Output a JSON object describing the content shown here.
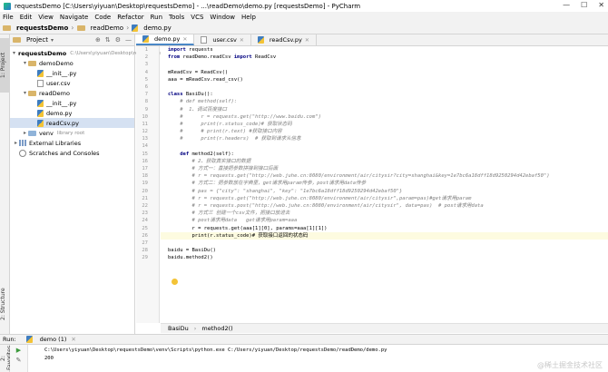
{
  "title_bar": {
    "title": "requestsDemo [C:\\Users\\yiyuan\\Desktop\\requestsDemo] - ...\\readDemo\\demo.py [requestsDemo] - PyCharm",
    "min_icon": "minimize-icon",
    "max_icon": "maximize-icon",
    "close_icon": "close-icon"
  },
  "menu": [
    "File",
    "Edit",
    "View",
    "Navigate",
    "Code",
    "Refactor",
    "Run",
    "Tools",
    "VCS",
    "Window",
    "Help"
  ],
  "breadcrumbs": [
    "requestsDemo",
    "readDemo",
    "demo.py"
  ],
  "side_tabs": {
    "project": "1: Project",
    "structure": "2: Structure",
    "favorites": "2: Favorites"
  },
  "project_panel": {
    "header_label": "Project",
    "tree": [
      {
        "indent": 0,
        "arrow": "▾",
        "icon": "folder",
        "name": "requestsDemo",
        "extra": "C:\\Users\\yiyuan\\Desktop\\requestsDemo",
        "bold": true
      },
      {
        "indent": 1,
        "arrow": "▾",
        "icon": "folder",
        "name": "demoDemo",
        "extra": ""
      },
      {
        "indent": 2,
        "arrow": "",
        "icon": "py",
        "name": "__init__.py",
        "extra": ""
      },
      {
        "indent": 2,
        "arrow": "",
        "icon": "csv",
        "name": "user.csv",
        "extra": ""
      },
      {
        "indent": 1,
        "arrow": "▾",
        "icon": "folder",
        "name": "readDemo",
        "extra": ""
      },
      {
        "indent": 2,
        "arrow": "",
        "icon": "py",
        "name": "__init__.py",
        "extra": ""
      },
      {
        "indent": 2,
        "arrow": "",
        "icon": "py",
        "name": "demo.py",
        "extra": ""
      },
      {
        "indent": 2,
        "arrow": "",
        "icon": "py",
        "name": "readCsv.py",
        "extra": "",
        "selected": true
      },
      {
        "indent": 1,
        "arrow": "▸",
        "icon": "folder-blue",
        "name": "venv",
        "extra": "library root"
      },
      {
        "indent": 0,
        "arrow": "▸",
        "icon": "lib",
        "name": "External Libraries",
        "extra": ""
      },
      {
        "indent": 0,
        "arrow": "",
        "icon": "scratch",
        "name": "Scratches and Consoles",
        "extra": ""
      }
    ]
  },
  "editor_tabs": [
    {
      "label": "demo.py",
      "active": true
    },
    {
      "label": "user.csv",
      "active": false
    },
    {
      "label": "readCsv.py",
      "active": false
    }
  ],
  "code_lines": [
    {
      "n": "1",
      "html": "<span class='kw'>import</span> requests"
    },
    {
      "n": "2",
      "html": "<span class='kw'>from</span> readDemo.readCsv <span class='kw'>import</span> ReadCsv"
    },
    {
      "n": "3",
      "html": ""
    },
    {
      "n": "4",
      "html": "mReadCsv = ReadCsv()"
    },
    {
      "n": "5",
      "html": "aaa = mReadCsv.read_csv()"
    },
    {
      "n": "6",
      "html": ""
    },
    {
      "n": "7",
      "html": "<span class='kw'>class</span> BasiDu():"
    },
    {
      "n": "8",
      "html": "    <span class='cm'># def method(self):</span>"
    },
    {
      "n": "9",
      "html": "    <span class='cm'>#  1、调试百度接口</span>"
    },
    {
      "n": "10",
      "html": "    <span class='cm'>#      r = requests.get(\"http://www.baidu.com\")</span>"
    },
    {
      "n": "11",
      "html": "    <span class='cm'>#      print(r.status_code)# 获取状态码</span>"
    },
    {
      "n": "12",
      "html": "    <span class='cm'>#      # print(r.text) #获取接口内容</span>"
    },
    {
      "n": "13",
      "html": "    <span class='cm'>#      print(r.headers)  # 获取到请求头信息</span>"
    },
    {
      "n": "14",
      "html": ""
    },
    {
      "n": "15",
      "html": "    <span class='kw'>def</span> method2(self):"
    },
    {
      "n": "16",
      "html": "        <span class='cm'># 2、获取真实接口的数据</span>"
    },
    {
      "n": "17",
      "html": "        <span class='cm'># 方式一：直接把参数拼接到接口后面</span>"
    },
    {
      "n": "18",
      "html": "        <span class='cm'># r = requests.get(\"http://web.juhe.cn:8080/environment/air/citysir?city=shanghai&key=1e7bc6a18dff18d9250294d42ebaf50\")</span>"
    },
    {
      "n": "19",
      "html": "        <span class='cm'># 方式二：把参数放在字典里，get请求用param传参，post请求用data传参</span>"
    },
    {
      "n": "20",
      "html": "        <span class='cm'># pas = {\"city\": \"shanghai\", \"key\": \"1e7bc6a18dff18d9250294d42ebaf50\"}</span>"
    },
    {
      "n": "21",
      "html": "        <span class='cm'># r = requests.get(\"http://web.juhe.cn:8080/environment/air/citysir\",param=pas)#get请求用param</span>"
    },
    {
      "n": "22",
      "html": "        <span class='cm'># r = requests.post(\"http://web.juhe.cn:8080/environment/air/citysir\", data=pas)  # post请求用data</span>"
    },
    {
      "n": "23",
      "html": "        <span class='cm'># 方式三 创建一个csv文件，把接口放进去</span>"
    },
    {
      "n": "24",
      "html": "        <span class='cm'># post请求用data   get请求用param=aaa</span>"
    },
    {
      "n": "25",
      "html": "        r = requests.get(aaa[1][0], params=aaa[1][1])"
    },
    {
      "n": "26",
      "html": "        print(r.status_code)# 获取接口返回的状态码",
      "current": true
    },
    {
      "n": "27",
      "html": ""
    },
    {
      "n": "28",
      "html": "baidu = BasiDu()"
    },
    {
      "n": "29",
      "html": "baidu.method2()"
    }
  ],
  "breadcrumb_bar": [
    "BasiDu",
    "method2()"
  ],
  "run_panel": {
    "label": "Run:",
    "tab": "demo (1)",
    "command": "C:\\Users\\yiyuan\\Desktop\\requestsDemo\\venv\\Scripts\\python.exe C:/Users/yiyuan/Desktop/requestsDemo/readDemo/demo.py",
    "output": "200"
  },
  "watermark": "@稀土掘金技术社区"
}
